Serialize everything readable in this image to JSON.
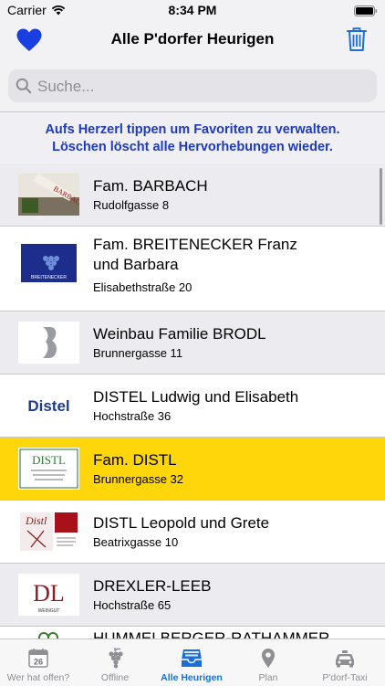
{
  "status_bar": {
    "carrier": "Carrier",
    "time": "8:34 PM"
  },
  "nav": {
    "title": "Alle P'dorfer Heurigen"
  },
  "search": {
    "placeholder": "Suche...",
    "value": ""
  },
  "info": {
    "line1": "Aufs Herzerl tippen um Favoriten zu verwalten.",
    "line2": "Löschen löscht alle Hervorhebungen wieder."
  },
  "list": {
    "items": [
      {
        "name": "Fam. BARBACH",
        "address": "Rudolfgasse 8"
      },
      {
        "name": "Fam. BREITENECKER Franz und Barbara",
        "address": "Elisabethstraße 20"
      },
      {
        "name": "Weinbau Familie BRODL",
        "address": "Brunnergasse 11"
      },
      {
        "name": "DISTEL Ludwig und Elisabeth",
        "address": "Hochstraße 36"
      },
      {
        "name": "Fam. DISTL",
        "address": "Brunnergasse 32",
        "highlighted": true
      },
      {
        "name": "DISTL Leopold und Grete",
        "address": "Beatrixgasse 10"
      },
      {
        "name": "DREXLER-LEEB",
        "address": "Hochstraße 65"
      },
      {
        "name": "HUMMELBERGER-RATHAMMER",
        "address": ""
      }
    ],
    "logos": {
      "barbach": "BARBACH",
      "breitenecker": "BREITENECKER",
      "distel": "Distel",
      "distl_card": "DISTL",
      "distl_script": "Distl",
      "drexler": "DL",
      "drexler_sub": "WEINGUT"
    }
  },
  "tabs": [
    {
      "label": "Wer hat offen?",
      "icon": "calendar-icon",
      "date": "26"
    },
    {
      "label": "Offline",
      "icon": "grapes-icon"
    },
    {
      "label": "Alle Heurigen",
      "icon": "tray-icon",
      "active": true
    },
    {
      "label": "Plan",
      "icon": "map-pin-icon"
    },
    {
      "label": "P'dorf-Taxi",
      "icon": "taxi-icon"
    }
  ],
  "colors": {
    "accent": "#1a6fd6",
    "heart": "#1a3fe0",
    "highlight_row": "#ffd60a",
    "shaded_row": "#ececf0",
    "info_text": "#1f3bbd"
  }
}
